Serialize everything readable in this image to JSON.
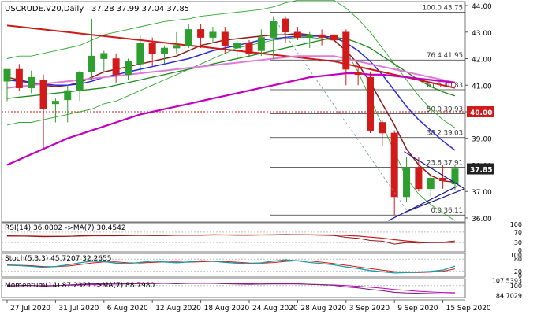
{
  "chart_data": {
    "type": "candlestick",
    "instrument_label": "USCRUDE.V20,Daily",
    "ohlc_header": "37.28 37.99 37.04 37.85",
    "current_price": "37.85",
    "marked_level": "40.00",
    "price_ylim": [
      35.85,
      44.15
    ],
    "price_ticks": [
      "44.00",
      "43.00",
      "42.00",
      "41.00",
      "40.00",
      "39.00",
      "38.00",
      "37.00",
      "36.00"
    ],
    "x_labels": [
      {
        "label": "27 Jul 2020",
        "index": 0
      },
      {
        "label": "31 Jul 2020",
        "index": 4
      },
      {
        "label": "6 Aug 2020",
        "index": 8
      },
      {
        "label": "12 Aug 2020",
        "index": 12
      },
      {
        "label": "18 Aug 2020",
        "index": 16
      },
      {
        "label": "24 Aug 2020",
        "index": 20
      },
      {
        "label": "28 Aug 2020",
        "index": 24
      },
      {
        "label": "3 Sep 2020",
        "index": 28
      },
      {
        "label": "9 Sep 2020",
        "index": 32
      },
      {
        "label": "15 Sep 2020",
        "index": 36
      }
    ],
    "candles": [
      {
        "o": 41.15,
        "h": 41.6,
        "l": 40.4,
        "c": 41.6
      },
      {
        "o": 41.6,
        "h": 41.8,
        "l": 40.8,
        "c": 40.9
      },
      {
        "o": 40.9,
        "h": 41.55,
        "l": 40.7,
        "c": 41.3
      },
      {
        "o": 41.2,
        "h": 41.4,
        "l": 38.6,
        "c": 40.1
      },
      {
        "o": 40.3,
        "h": 40.5,
        "l": 39.6,
        "c": 40.4
      },
      {
        "o": 40.45,
        "h": 41.0,
        "l": 39.6,
        "c": 40.8
      },
      {
        "o": 40.8,
        "h": 41.55,
        "l": 40.4,
        "c": 41.5
      },
      {
        "o": 41.5,
        "h": 43.5,
        "l": 41.2,
        "c": 42.1
      },
      {
        "o": 42.0,
        "h": 42.3,
        "l": 41.5,
        "c": 42.2
      },
      {
        "o": 42.0,
        "h": 42.2,
        "l": 41.1,
        "c": 41.4
      },
      {
        "o": 41.4,
        "h": 42.0,
        "l": 41.2,
        "c": 41.9
      },
      {
        "o": 41.8,
        "h": 42.9,
        "l": 41.5,
        "c": 42.6
      },
      {
        "o": 42.6,
        "h": 42.8,
        "l": 41.7,
        "c": 42.2
      },
      {
        "o": 42.2,
        "h": 42.5,
        "l": 41.8,
        "c": 42.4
      },
      {
        "o": 42.4,
        "h": 43.0,
        "l": 42.2,
        "c": 42.5
      },
      {
        "o": 42.5,
        "h": 43.3,
        "l": 42.4,
        "c": 43.1
      },
      {
        "o": 43.1,
        "h": 43.3,
        "l": 42.4,
        "c": 42.8
      },
      {
        "o": 42.8,
        "h": 43.2,
        "l": 42.6,
        "c": 43.0
      },
      {
        "o": 43.0,
        "h": 43.2,
        "l": 42.2,
        "c": 42.5
      },
      {
        "o": 42.4,
        "h": 42.8,
        "l": 41.9,
        "c": 42.6
      },
      {
        "o": 42.6,
        "h": 42.7,
        "l": 42.1,
        "c": 42.2
      },
      {
        "o": 42.3,
        "h": 43.1,
        "l": 42.1,
        "c": 42.8
      },
      {
        "o": 42.8,
        "h": 43.6,
        "l": 42.0,
        "c": 43.4
      },
      {
        "o": 43.5,
        "h": 43.6,
        "l": 42.6,
        "c": 43.0
      },
      {
        "o": 43.0,
        "h": 43.2,
        "l": 42.7,
        "c": 42.8
      },
      {
        "o": 42.8,
        "h": 43.0,
        "l": 42.4,
        "c": 42.9
      },
      {
        "o": 42.9,
        "h": 43.1,
        "l": 42.5,
        "c": 42.8
      },
      {
        "o": 42.9,
        "h": 43.1,
        "l": 42.6,
        "c": 42.7
      },
      {
        "o": 43.0,
        "h": 43.1,
        "l": 41.0,
        "c": 41.6
      },
      {
        "o": 41.5,
        "h": 41.7,
        "l": 41.0,
        "c": 41.4
      },
      {
        "o": 41.3,
        "h": 41.5,
        "l": 39.2,
        "c": 39.3
      },
      {
        "o": 39.6,
        "h": 39.7,
        "l": 38.7,
        "c": 39.2
      },
      {
        "o": 39.2,
        "h": 39.3,
        "l": 36.1,
        "c": 36.8
      },
      {
        "o": 36.8,
        "h": 38.3,
        "l": 36.6,
        "c": 37.9
      },
      {
        "o": 37.9,
        "h": 38.3,
        "l": 37.0,
        "c": 37.1
      },
      {
        "o": 37.1,
        "h": 37.6,
        "l": 36.8,
        "c": 37.5
      },
      {
        "o": 37.5,
        "h": 38.0,
        "l": 37.1,
        "c": 37.4
      },
      {
        "o": 37.28,
        "h": 37.99,
        "l": 37.04,
        "c": 37.85
      }
    ],
    "fibonacci": [
      {
        "label": "100.0 43.75",
        "value": 43.75
      },
      {
        "label": "76.4 41.95",
        "value": 41.95
      },
      {
        "label": "61.8 40.83",
        "value": 40.83
      },
      {
        "label": "50.0 39.93",
        "value": 39.93
      },
      {
        "label": "38.2 39.03",
        "value": 39.03
      },
      {
        "label": "23.6 37.91",
        "value": 37.91
      },
      {
        "label": "0.0 36.11",
        "value": 36.11
      }
    ],
    "moving_averages": [
      {
        "color": "#8b1a1a",
        "values": [
          41.3,
          41.2,
          41.1,
          41.0,
          40.95,
          41.0,
          41.1,
          41.3,
          41.5,
          41.6,
          41.7,
          41.8,
          41.9,
          42.0,
          42.1,
          42.3,
          42.5,
          42.6,
          42.7,
          42.75,
          42.8,
          42.85,
          42.9,
          42.9,
          42.95,
          42.9,
          42.85,
          42.7,
          42.3,
          41.8,
          41.1,
          40.3,
          39.5,
          38.6,
          38.0,
          37.6,
          37.4,
          37.35
        ]
      },
      {
        "color": "#2a2ad8",
        "values": [
          41.2,
          41.15,
          41.1,
          41.05,
          41.0,
          41.0,
          41.05,
          41.15,
          41.3,
          41.4,
          41.5,
          41.6,
          41.7,
          41.8,
          41.9,
          42.0,
          42.15,
          42.3,
          42.4,
          42.5,
          42.6,
          42.7,
          42.75,
          42.8,
          42.85,
          42.85,
          42.85,
          42.8,
          42.6,
          42.3,
          41.9,
          41.4,
          40.8,
          40.2,
          39.7,
          39.3,
          38.9,
          38.55
        ]
      },
      {
        "color": "#1a8a1a",
        "values": [
          40.5,
          40.55,
          40.6,
          40.65,
          40.7,
          40.75,
          40.8,
          40.85,
          40.9,
          41.0,
          41.1,
          41.2,
          41.3,
          41.4,
          41.5,
          41.6,
          41.7,
          41.8,
          41.9,
          42.0,
          42.1,
          42.2,
          42.3,
          42.4,
          42.5,
          42.6,
          42.7,
          42.8,
          42.75,
          42.6,
          42.4,
          42.1,
          41.8,
          41.5,
          41.2,
          40.95,
          40.75,
          40.6
        ]
      },
      {
        "color": "#cc1a1a",
        "values": [
          43.25,
          43.2,
          43.15,
          43.1,
          43.05,
          43.0,
          42.95,
          42.9,
          42.85,
          42.8,
          42.75,
          42.7,
          42.65,
          42.6,
          42.55,
          42.5,
          42.45,
          42.4,
          42.35,
          42.3,
          42.25,
          42.2,
          42.15,
          42.1,
          42.05,
          42.0,
          41.95,
          41.9,
          41.8,
          41.7,
          41.6,
          41.5,
          41.4,
          41.3,
          41.2,
          41.1,
          41.0,
          40.9
        ]
      },
      {
        "color": "#e07ad8",
        "values": [
          40.9,
          40.95,
          41.0,
          41.05,
          41.1,
          41.15,
          41.2,
          41.25,
          41.3,
          41.35,
          41.4,
          41.45,
          41.5,
          41.55,
          41.6,
          41.65,
          41.7,
          41.75,
          41.8,
          41.85,
          41.9,
          41.95,
          42.0,
          42.05,
          42.1,
          42.1,
          42.1,
          42.1,
          42.0,
          41.9,
          41.8,
          41.7,
          41.6,
          41.5,
          41.4,
          41.3,
          41.2,
          41.1
        ]
      },
      {
        "color": "#c000c0",
        "values": [
          38.0,
          38.2,
          38.4,
          38.6,
          38.8,
          39.0,
          39.15,
          39.3,
          39.45,
          39.6,
          39.75,
          39.9,
          40.0,
          40.1,
          40.2,
          40.3,
          40.4,
          40.5,
          40.6,
          40.7,
          40.8,
          40.9,
          41.0,
          41.1,
          41.2,
          41.3,
          41.35,
          41.4,
          41.45,
          41.45,
          41.4,
          41.4,
          41.35,
          41.3,
          41.25,
          41.2,
          41.15,
          41.1
        ]
      }
    ],
    "bollinger": {
      "color": "#2ea82e",
      "upper": [
        42.0,
        42.1,
        42.1,
        42.2,
        42.3,
        42.4,
        42.5,
        42.7,
        42.9,
        43.0,
        43.1,
        43.2,
        43.3,
        43.4,
        43.45,
        43.5,
        43.6,
        43.65,
        43.7,
        43.75,
        43.8,
        43.85,
        43.95,
        44.1,
        44.2,
        44.2,
        44.2,
        44.2,
        43.9,
        43.5,
        43.0,
        42.4,
        41.8,
        41.2,
        40.6,
        40.1,
        39.7,
        39.4
      ],
      "lower": [
        39.5,
        39.6,
        39.6,
        39.7,
        39.8,
        39.9,
        40.0,
        40.1,
        40.3,
        40.4,
        40.6,
        40.8,
        41.0,
        41.2,
        41.4,
        41.6,
        41.8,
        42.0,
        42.2,
        42.4,
        42.5,
        42.6,
        42.7,
        42.75,
        42.8,
        42.8,
        42.75,
        42.7,
        42.3,
        41.5,
        40.5,
        39.5,
        38.5,
        37.5,
        36.9,
        36.5,
        36.2,
        35.9
      ]
    },
    "dashed_trend": {
      "from_index": 22,
      "from_value": 43.55,
      "to_index": 33,
      "to_value": 36.3
    },
    "wedge": [
      {
        "i1": 32.8,
        "v1": 38.5,
        "i2": 37.8,
        "v2": 37.1
      },
      {
        "i1": 32.8,
        "v1": 36.2,
        "i2": 37.8,
        "v2": 37.1
      },
      {
        "i1": 31.5,
        "v1": 35.9,
        "i2": 37.2,
        "v2": 37.2
      }
    ],
    "rsi": {
      "label": "RSI(14) 36.0802 ->MA(7) 30.4542",
      "ticks": [
        "100",
        "70",
        "30",
        "0"
      ],
      "ylim": [
        0,
        100
      ],
      "levels": [
        70,
        30
      ],
      "rsi": [
        56,
        55,
        54,
        52,
        53,
        54,
        56,
        58,
        57,
        56,
        57,
        58,
        57,
        57,
        58,
        59,
        59,
        60,
        59,
        58,
        58,
        59,
        60,
        61,
        60,
        59,
        58,
        57,
        50,
        46,
        38,
        35,
        24,
        30,
        28,
        30,
        31,
        36
      ],
      "ma": [
        55,
        55,
        55,
        54,
        54,
        54,
        55,
        56,
        56,
        56,
        57,
        57,
        57,
        57,
        58,
        58,
        58,
        59,
        59,
        59,
        59,
        59,
        59,
        60,
        60,
        60,
        59,
        59,
        57,
        55,
        51,
        47,
        41,
        36,
        32,
        30,
        30,
        30.45
      ]
    },
    "stoch": {
      "label": "Stoch(5,3,3) 45.7207 32.2655",
      "ticks": [
        "100",
        "80",
        "20",
        "0"
      ],
      "ylim": [
        0,
        100
      ],
      "levels": [
        80,
        20
      ],
      "k": [
        50,
        48,
        45,
        40,
        44,
        52,
        62,
        70,
        68,
        60,
        58,
        64,
        70,
        66,
        62,
        66,
        72,
        70,
        64,
        60,
        58,
        62,
        70,
        76,
        72,
        64,
        58,
        52,
        42,
        34,
        24,
        18,
        12,
        14,
        16,
        20,
        26,
        45.7
      ],
      "d": [
        52,
        50,
        48,
        44,
        43,
        46,
        53,
        61,
        66,
        66,
        62,
        61,
        64,
        66,
        66,
        65,
        67,
        69,
        68,
        65,
        61,
        60,
        63,
        69,
        72,
        71,
        65,
        58,
        50,
        42,
        34,
        26,
        19,
        15,
        14,
        16,
        20,
        32.3
      ]
    },
    "momentum": {
      "label": "Momentum(14) 87.2321 ->MA(7) 88.7980",
      "ticks": [
        "107.5393",
        "100",
        "84.7029"
      ],
      "ylim": [
        83.8,
        108.4
      ],
      "level": 100,
      "mom": [
        99,
        100,
        100.5,
        99,
        100,
        101,
        102,
        103,
        103,
        102.5,
        103,
        104,
        104,
        103.5,
        103,
        103.5,
        104,
        103.5,
        103,
        102.5,
        102,
        102.5,
        103,
        103.5,
        103,
        102,
        101.5,
        100.5,
        98,
        96.5,
        94,
        92,
        89.5,
        88.5,
        88,
        87.5,
        87,
        87.2
      ],
      "ma": [
        100,
        100,
        100,
        100,
        100,
        100.5,
        101,
        101.5,
        102,
        102.5,
        102.5,
        103,
        103,
        103.5,
        103.5,
        103.5,
        103.5,
        103.5,
        103.5,
        103,
        103,
        102.5,
        102.5,
        102.5,
        102.5,
        102,
        101.5,
        101,
        100,
        99,
        97.5,
        96,
        94,
        92.5,
        91,
        90,
        89.2,
        88.8
      ]
    }
  }
}
